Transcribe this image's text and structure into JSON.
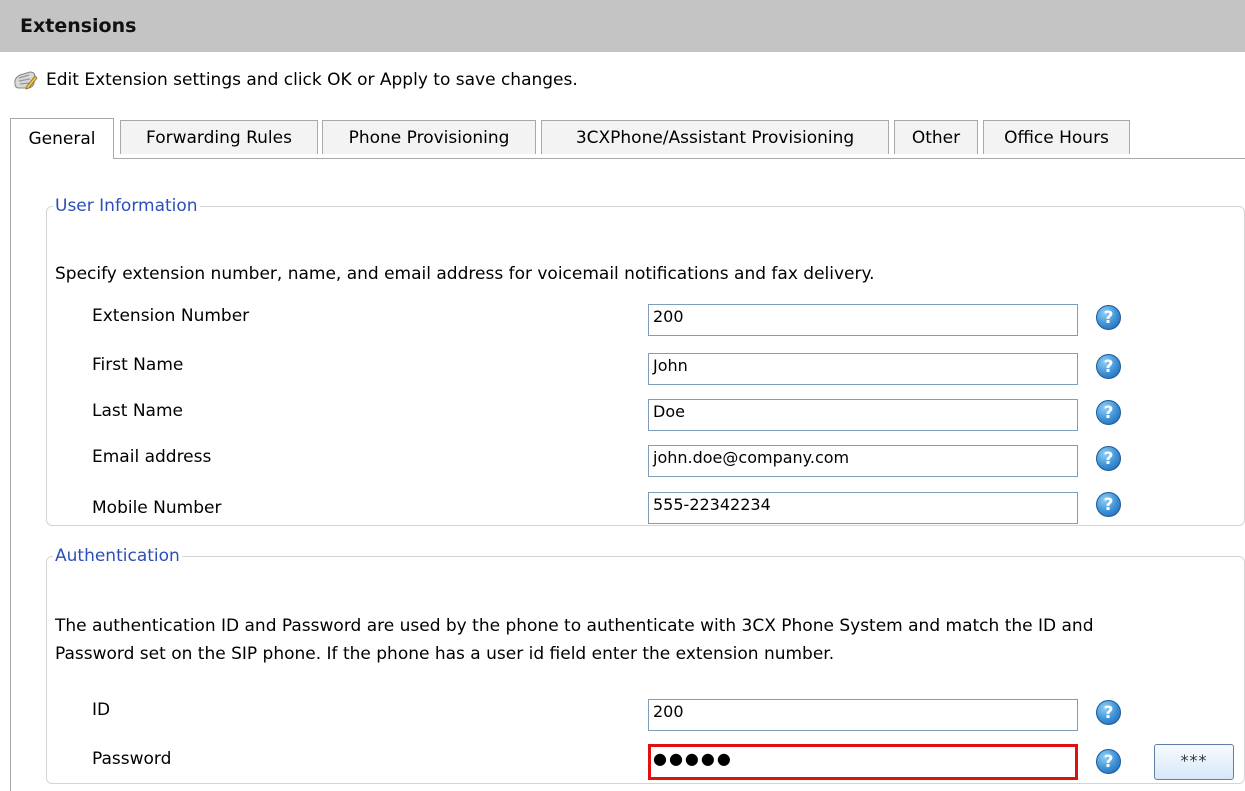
{
  "header": {
    "title": "Extensions"
  },
  "intro": {
    "icon": "phone-edit-icon",
    "text": "Edit Extension settings and click OK or Apply to save changes."
  },
  "tabs": [
    {
      "label": "General",
      "active": true
    },
    {
      "label": "Forwarding Rules",
      "active": false
    },
    {
      "label": "Phone Provisioning",
      "active": false
    },
    {
      "label": "3CXPhone/Assistant Provisioning",
      "active": false
    },
    {
      "label": "Other",
      "active": false
    },
    {
      "label": "Office Hours",
      "active": false
    }
  ],
  "user_info": {
    "legend": "User Information",
    "description": "Specify extension number, name, and email address for voicemail notifications and fax delivery.",
    "fields": [
      {
        "label": "Extension Number",
        "value": "200"
      },
      {
        "label": "First Name",
        "value": "John"
      },
      {
        "label": "Last Name",
        "value": "Doe"
      },
      {
        "label": "Email address",
        "value": "john.doe@company.com"
      },
      {
        "label": "Mobile Number",
        "value": "555-22342234"
      }
    ]
  },
  "auth": {
    "legend": "Authentication",
    "description_line1": "The authentication ID and Password are used by the phone to authenticate with 3CX Phone System and match the ID and",
    "description_line2": "Password set on the SIP phone. If the phone has a user id field enter the extension number.",
    "id_label": "ID",
    "id_value": "200",
    "password_label": "Password",
    "password_mask": "●●●●●",
    "show_password_label": "***"
  },
  "help_icon": "?",
  "colors": {
    "header_bg": "#c4c4c4",
    "legend": "#2b4fb8",
    "error_border": "#e01010",
    "help_blue": "#3b8fd4"
  }
}
